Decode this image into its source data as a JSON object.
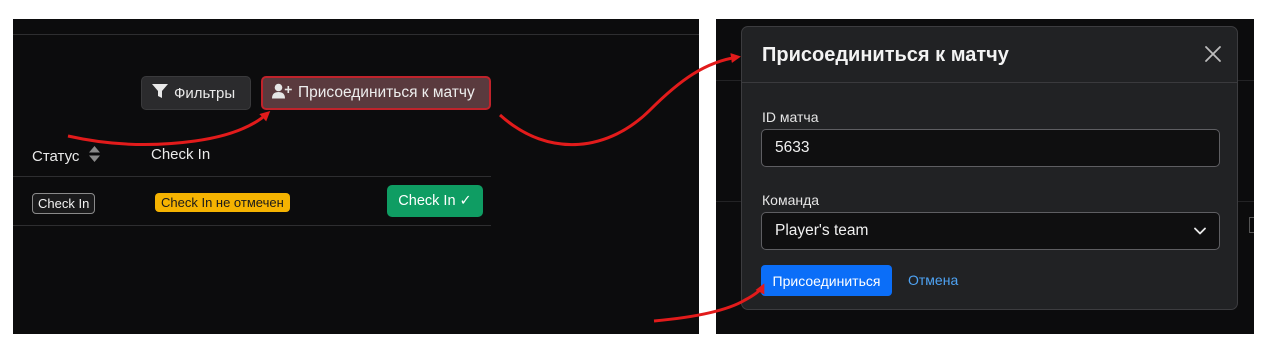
{
  "left": {
    "filters_label": "Фильтры",
    "join_label": "Присоединиться к матчу",
    "headers": {
      "status": "Статус",
      "checkin": "Check In"
    },
    "row": {
      "status_badge": "Check In",
      "checkin_badge": "Check In не отмечен",
      "checkin_button": "Check In ✓"
    }
  },
  "modal": {
    "title": "Присоединиться к матчу",
    "match_label": "ID матча",
    "match_value": "5633",
    "team_label": "Команда",
    "team_value": "Player's team",
    "submit_label": "Присоединиться",
    "cancel_label": "Отмена"
  },
  "colors": {
    "panel_bg": "#0c0c0d",
    "modal_bg": "#212224",
    "annotation_red": "#e21b1b",
    "checkin_green": "#0f9d63",
    "checkin_badge_yellow": "#f5b301",
    "primary_blue": "#0b6ef8"
  },
  "icons": [
    "filter-icon",
    "user-plus-icon",
    "sort-icon",
    "close-icon",
    "chevron-down-icon"
  ]
}
